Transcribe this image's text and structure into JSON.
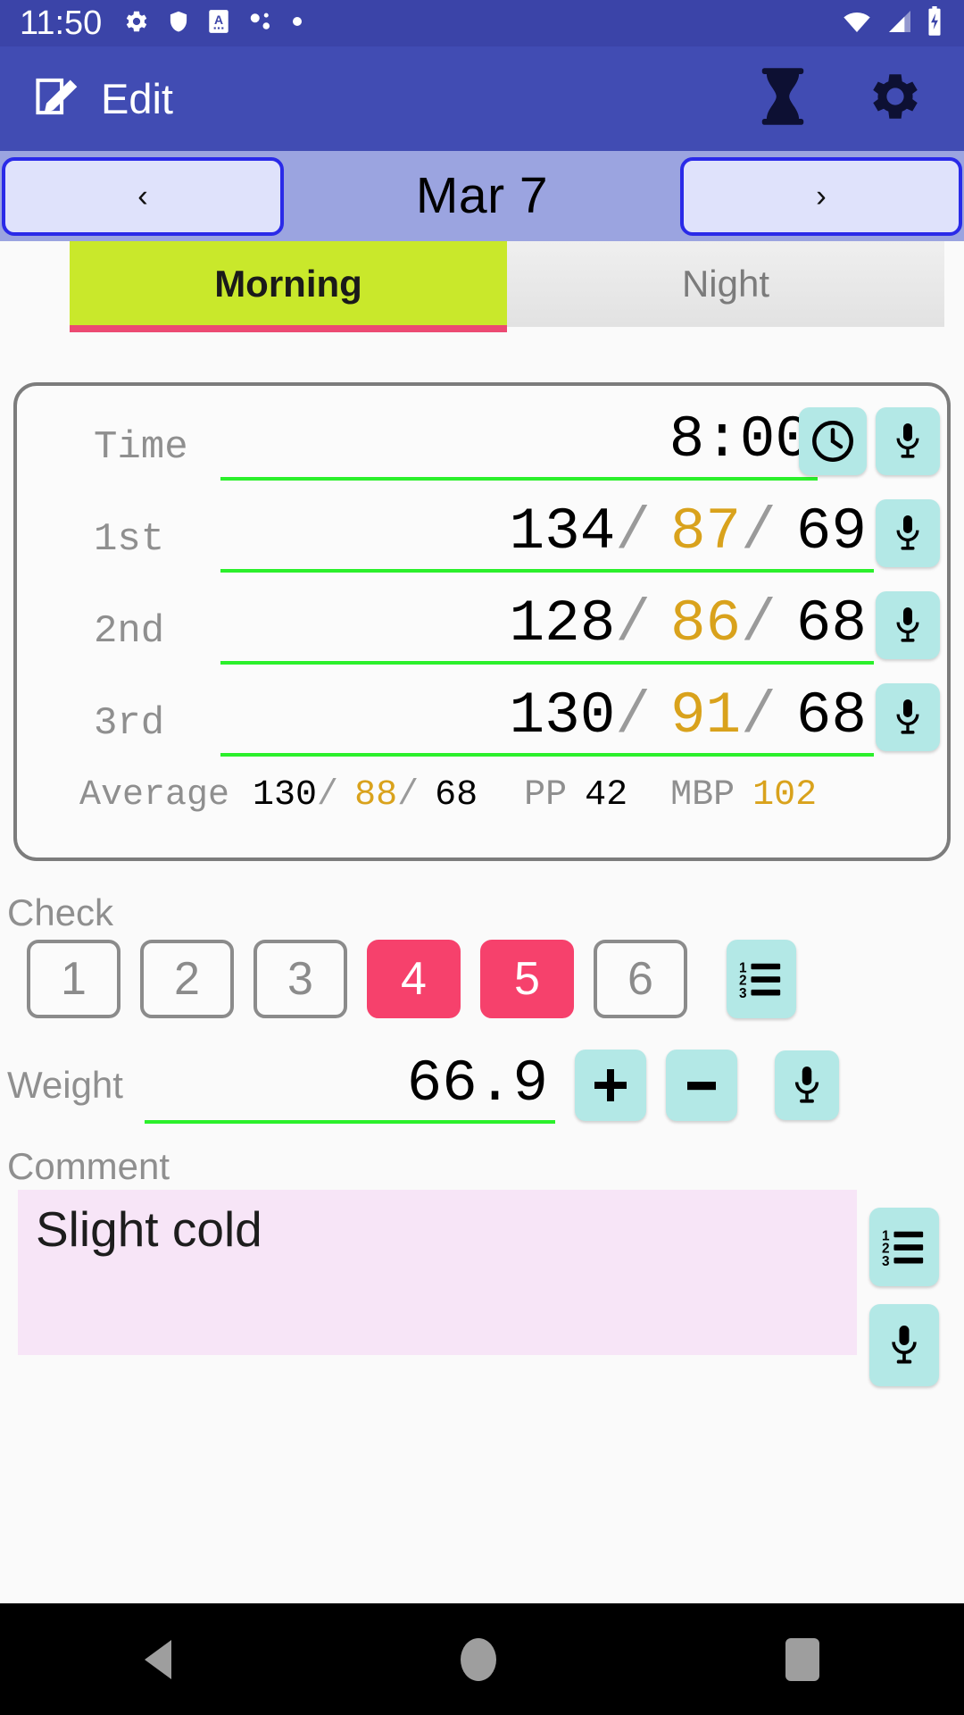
{
  "status_bar": {
    "clock": "11:50",
    "left_icons": [
      "gear-icon",
      "shield-icon",
      "a-box-icon",
      "bubbles-icon",
      "dot-icon"
    ],
    "right_icons": [
      "wifi-icon",
      "signal-icon",
      "battery-charging-icon"
    ],
    "background": "#3b44a8"
  },
  "app_bar": {
    "edit_icon": "edit-pencil-icon",
    "title": "Edit",
    "hourglass_icon": "hourglass-icon",
    "settings_icon": "gear-icon",
    "background": "#414cb3"
  },
  "date_nav": {
    "prev_label": "‹",
    "next_label": "›",
    "date": "Mar 7",
    "background": "#9ba4e0",
    "button_border": "#2a2ae8"
  },
  "tabs": [
    {
      "label": "Morning",
      "active": true,
      "color": "#c9e82b",
      "indicator": "#ec4a72"
    },
    {
      "label": "Night",
      "active": false,
      "color": "#e7e7e7"
    }
  ],
  "measurement_card": {
    "time_row": {
      "label": "Time",
      "value": "8:00",
      "clock_button": "clock-icon",
      "mic_button": "microphone-icon"
    },
    "readings": [
      {
        "label": "1st",
        "systolic": "134",
        "diastolic": "87",
        "pulse": "69",
        "separator": "/",
        "mic_button": "microphone-icon"
      },
      {
        "label": "2nd",
        "systolic": "128",
        "diastolic": "86",
        "pulse": "68",
        "separator": "/",
        "mic_button": "microphone-icon"
      },
      {
        "label": "3rd",
        "systolic": "130",
        "diastolic": "91",
        "pulse": "68",
        "separator": "/",
        "mic_button": "microphone-icon"
      }
    ],
    "summary": {
      "average_label": "Average",
      "avg_systolic": "130",
      "avg_diastolic": "88",
      "avg_pulse": "68",
      "separator": "/",
      "pp_label": "PP",
      "pp_value": "42",
      "mbp_label": "MBP",
      "mbp_value": "102"
    },
    "colors": {
      "diastolic": "#d9a21c",
      "underline": "#2bf02b",
      "mic_button_bg": "#b3e8e6",
      "label": "#8f8f8f"
    }
  },
  "check": {
    "label": "Check",
    "buttons": [
      {
        "label": "1",
        "selected": false
      },
      {
        "label": "2",
        "selected": false
      },
      {
        "label": "3",
        "selected": false
      },
      {
        "label": "4",
        "selected": true
      },
      {
        "label": "5",
        "selected": true
      },
      {
        "label": "6",
        "selected": false
      }
    ],
    "list_button": "numbered-list-icon",
    "selected_color": "#f6416c"
  },
  "weight": {
    "label": "Weight",
    "value": "66.9",
    "plus_button": "plus-icon",
    "minus_button": "minus-icon",
    "mic_button": "microphone-icon"
  },
  "comment": {
    "label": "Comment",
    "value": "Slight cold",
    "placeholder": "",
    "background": "#f7e5f7",
    "list_button": "numbered-list-icon",
    "mic_button": "microphone-icon"
  },
  "nav_bar": {
    "back": "back-triangle-icon",
    "home": "home-circle-icon",
    "recents": "recents-square-icon"
  }
}
